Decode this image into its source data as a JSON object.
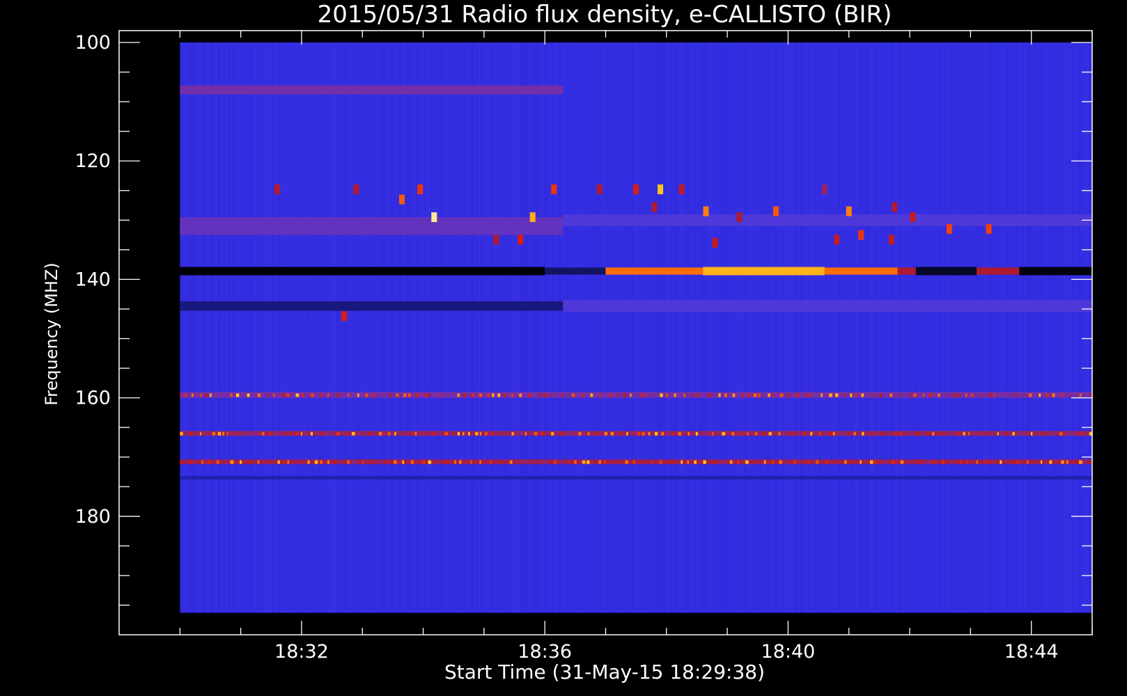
{
  "colors": {
    "background": "#000000",
    "frame": "#ffffff",
    "text": "#ffffff",
    "colormap": [
      "#000000",
      "#12125a",
      "#2a2ae6",
      "#5038d8",
      "#7e2c9a",
      "#b01a2a",
      "#e01e10",
      "#ff6a0a",
      "#ffcc20",
      "#fffff0"
    ]
  },
  "chart_data": {
    "type": "heatmap",
    "title": "2015/05/31  Radio flux density, e-CALLISTO (BIR)",
    "xlabel": "Start Time (31-May-15 18:29:38)",
    "ylabel": "Frequency (MHZ)",
    "x_unit": "minutes after 18:00",
    "x_range": [
      29.0,
      45.0
    ],
    "x_ticks": [
      32,
      36,
      40,
      44
    ],
    "x_tick_labels": [
      "18:32",
      "18:36",
      "18:40",
      "18:44"
    ],
    "x_minor_ticks": [
      30,
      31,
      32,
      33,
      34,
      35,
      36,
      37,
      38,
      39,
      40,
      41,
      42,
      43,
      44,
      45
    ],
    "y_range": [
      98,
      200
    ],
    "y_inverted": true,
    "y_ticks": [
      100,
      120,
      140,
      160,
      180
    ],
    "y_minor_ticks": [
      100,
      105,
      110,
      115,
      120,
      125,
      130,
      135,
      140,
      145,
      150,
      155,
      160,
      165,
      170,
      175,
      180,
      185,
      190,
      195
    ],
    "data_extent": {
      "x": [
        30.0,
        45.0
      ],
      "y": [
        100,
        196.3
      ]
    },
    "intensity_scale": "0 = low (black), 1 = high (white); background ~0.25 (blue)",
    "background_intensity": 0.25,
    "bands": [
      {
        "freq": 138.6,
        "width_mhz": 1.4,
        "x": [
          30.0,
          36.0
        ],
        "level": 0.0
      },
      {
        "freq": 138.6,
        "width_mhz": 1.2,
        "x": [
          36.0,
          37.0
        ],
        "level": 0.12
      },
      {
        "freq": 138.6,
        "width_mhz": 1.2,
        "x": [
          37.0,
          38.6
        ],
        "level": 0.78
      },
      {
        "freq": 138.6,
        "width_mhz": 1.4,
        "x": [
          38.6,
          40.6
        ],
        "level": 0.86
      },
      {
        "freq": 138.6,
        "width_mhz": 1.2,
        "x": [
          40.6,
          41.8
        ],
        "level": 0.78
      },
      {
        "freq": 138.6,
        "width_mhz": 1.2,
        "x": [
          41.8,
          42.1
        ],
        "level": 0.55
      },
      {
        "freq": 138.6,
        "width_mhz": 1.4,
        "x": [
          42.1,
          43.1
        ],
        "level": 0.05
      },
      {
        "freq": 138.6,
        "width_mhz": 1.2,
        "x": [
          43.1,
          43.8
        ],
        "level": 0.55
      },
      {
        "freq": 138.6,
        "width_mhz": 1.4,
        "x": [
          43.8,
          45.0
        ],
        "level": 0.02
      },
      {
        "freq": 108,
        "width_mhz": 1.5,
        "x": [
          30.0,
          36.3
        ],
        "level": 0.42
      },
      {
        "freq": 131,
        "width_mhz": 3.0,
        "x": [
          30.0,
          36.3
        ],
        "level": 0.38
      },
      {
        "freq": 130,
        "width_mhz": 2.0,
        "x": [
          36.3,
          45.0
        ],
        "level": 0.33
      },
      {
        "freq": 144.5,
        "width_mhz": 1.6,
        "x": [
          30.0,
          36.3
        ],
        "level": 0.14
      },
      {
        "freq": 144.5,
        "width_mhz": 2.0,
        "x": [
          36.3,
          45.0
        ],
        "level": 0.33
      },
      {
        "freq": 159.5,
        "width_mhz": 1.0,
        "x": [
          30.0,
          45.0
        ],
        "level": 0.42
      },
      {
        "freq": 166,
        "width_mhz": 0.8,
        "x": [
          30.0,
          45.0
        ],
        "level": 0.5
      },
      {
        "freq": 170.8,
        "width_mhz": 0.8,
        "x": [
          30.0,
          45.0
        ],
        "level": 0.52
      },
      {
        "freq": 173.5,
        "width_mhz": 0.6,
        "x": [
          30.0,
          45.0
        ],
        "level": 0.18
      }
    ],
    "bursts": [
      {
        "x": 34.18,
        "freq": 129.5,
        "level": 0.95
      },
      {
        "x": 35.8,
        "freq": 129.5,
        "level": 0.85
      },
      {
        "x": 37.9,
        "freq": 124.8,
        "level": 0.88
      },
      {
        "x": 41.0,
        "freq": 128.5,
        "level": 0.8
      },
      {
        "x": 33.65,
        "freq": 126.5,
        "level": 0.75
      },
      {
        "x": 33.95,
        "freq": 124.8,
        "level": 0.7
      },
      {
        "x": 36.15,
        "freq": 124.8,
        "level": 0.7
      },
      {
        "x": 38.65,
        "freq": 128.5,
        "level": 0.8
      },
      {
        "x": 39.8,
        "freq": 128.5,
        "level": 0.75
      },
      {
        "x": 41.2,
        "freq": 132.5,
        "level": 0.7
      },
      {
        "x": 42.65,
        "freq": 131.5,
        "level": 0.72
      },
      {
        "x": 43.3,
        "freq": 131.5,
        "level": 0.72
      },
      {
        "x": 32.7,
        "freq": 146.2,
        "level": 0.65
      },
      {
        "x": 37.5,
        "freq": 124.8,
        "level": 0.65
      },
      {
        "x": 35.6,
        "freq": 133.3,
        "level": 0.65
      },
      {
        "x": 40.8,
        "freq": 133.3,
        "level": 0.6
      },
      {
        "x": 41.7,
        "freq": 133.3,
        "level": 0.6
      },
      {
        "x": 38.8,
        "freq": 133.8,
        "level": 0.6
      },
      {
        "x": 42.05,
        "freq": 129.5,
        "level": 0.6
      },
      {
        "x": 38.25,
        "freq": 124.8,
        "level": 0.6
      },
      {
        "x": 36.9,
        "freq": 124.8,
        "level": 0.55
      },
      {
        "x": 31.6,
        "freq": 124.8,
        "level": 0.55
      },
      {
        "x": 32.9,
        "freq": 124.8,
        "level": 0.55
      },
      {
        "x": 35.2,
        "freq": 133.3,
        "level": 0.55
      },
      {
        "x": 37.8,
        "freq": 127.8,
        "level": 0.55
      },
      {
        "x": 39.2,
        "freq": 129.5,
        "level": 0.55
      },
      {
        "x": 40.6,
        "freq": 124.8,
        "level": 0.5
      },
      {
        "x": 41.75,
        "freq": 127.8,
        "level": 0.55
      }
    ]
  }
}
